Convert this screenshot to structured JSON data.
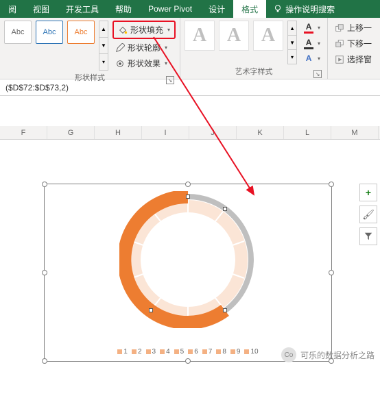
{
  "ribbon": {
    "tabs": [
      "阅",
      "视图",
      "开发工具",
      "帮助",
      "Power Pivot",
      "设计",
      "格式"
    ],
    "active_tab": "格式",
    "tell_me": "操作说明搜索"
  },
  "shape_styles": {
    "thumbs": [
      "Abc",
      "Abc",
      "Abc"
    ],
    "fill": "形状填充",
    "outline": "形状轮廓",
    "effects": "形状效果",
    "group_label": "形状样式"
  },
  "wordart": {
    "thumbs": [
      "A",
      "A",
      "A"
    ],
    "group_label": "艺术字样式"
  },
  "arrange": {
    "bring_forward": "上移一",
    "send_backward": "下移一",
    "selection_pane": "选择窗"
  },
  "formula": "($D$72:$D$73,2)",
  "columns": [
    "F",
    "G",
    "H",
    "I",
    "J",
    "K",
    "L",
    "M"
  ],
  "chart_data": {
    "type": "pie",
    "title": "",
    "categories": [
      "1",
      "2",
      "3",
      "4",
      "5",
      "6",
      "7",
      "8",
      "9",
      "10"
    ],
    "values": [
      10,
      10,
      10,
      10,
      10,
      10,
      10,
      10,
      10,
      10
    ],
    "highlighted_slices": [
      0,
      1,
      2,
      3,
      4,
      5
    ],
    "colors": {
      "highlight": "#ed7d31",
      "normal": "#fbe5d6",
      "ring_outline": "#bfbfbf"
    },
    "legend_position": "bottom"
  },
  "side_tools": {
    "plus": "+",
    "brush": "🖌",
    "filter": "⧩"
  },
  "watermark": {
    "logo": "Co",
    "text": "可乐的数据分析之路"
  }
}
